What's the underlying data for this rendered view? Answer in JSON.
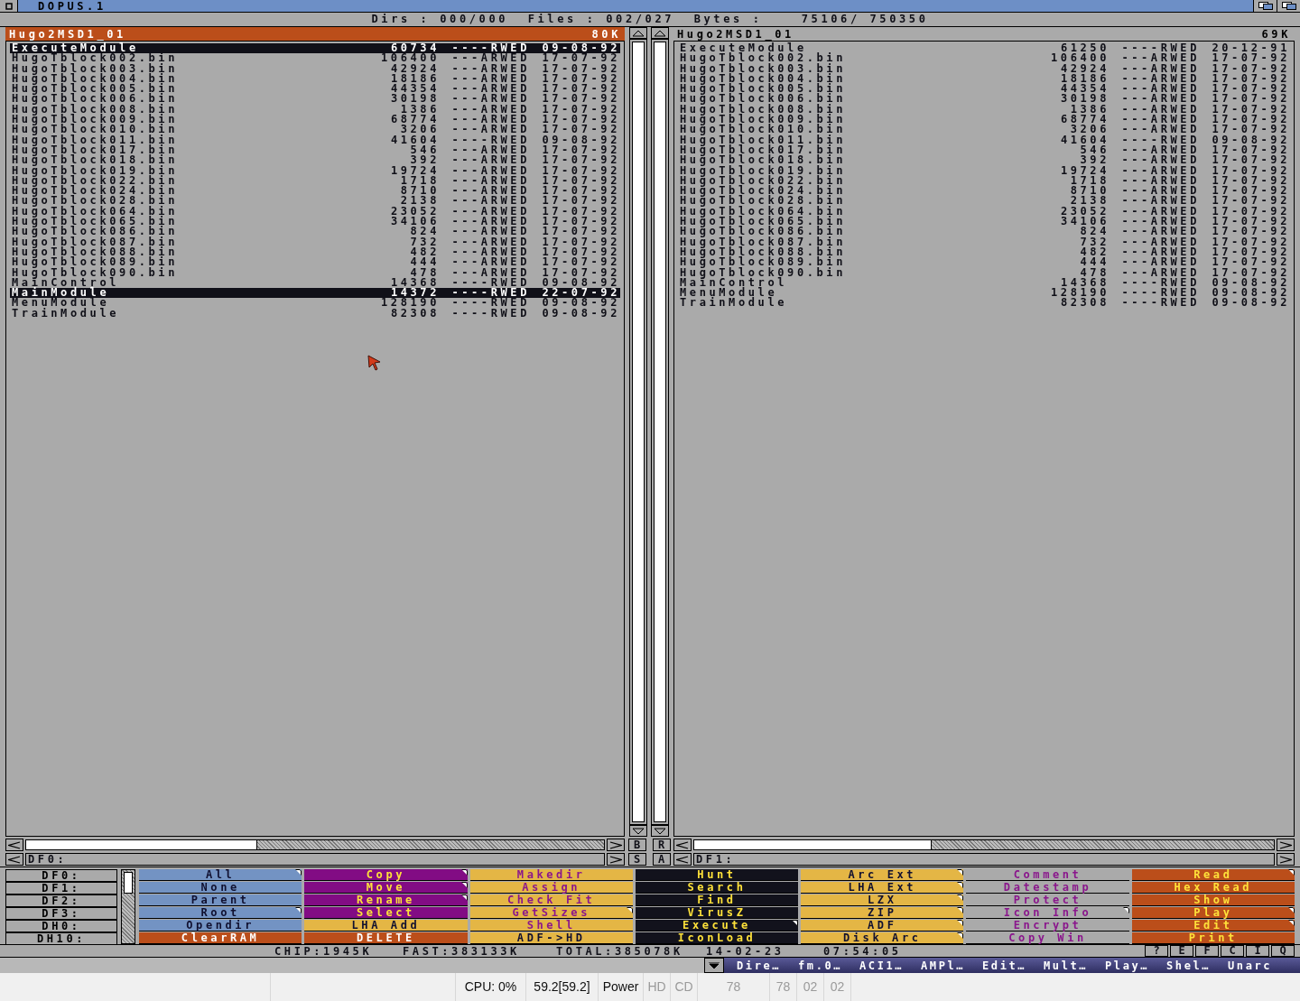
{
  "window": {
    "title": "DOPUS.1"
  },
  "info_line": "Dirs : 000/000  Files : 002/027  Bytes :    75106/ 750350",
  "panels": [
    {
      "title": "Hugo2MSD1_01",
      "free": "80K",
      "active": true,
      "path": "DF0:",
      "files": [
        {
          "name": "ExecuteModule",
          "size": "60734",
          "protection": "----RWED",
          "date": "09-08-92",
          "selected": true
        },
        {
          "name": "HugoTblock002.bin",
          "size": "106400",
          "protection": "---ARWED",
          "date": "17-07-92",
          "selected": false
        },
        {
          "name": "HugoTblock003.bin",
          "size": "42924",
          "protection": "---ARWED",
          "date": "17-07-92",
          "selected": false
        },
        {
          "name": "HugoTblock004.bin",
          "size": "18186",
          "protection": "---ARWED",
          "date": "17-07-92",
          "selected": false
        },
        {
          "name": "HugoTblock005.bin",
          "size": "44354",
          "protection": "---ARWED",
          "date": "17-07-92",
          "selected": false
        },
        {
          "name": "HugoTblock006.bin",
          "size": "30198",
          "protection": "---ARWED",
          "date": "17-07-92",
          "selected": false
        },
        {
          "name": "HugoTblock008.bin",
          "size": "1386",
          "protection": "---ARWED",
          "date": "17-07-92",
          "selected": false
        },
        {
          "name": "HugoTblock009.bin",
          "size": "68774",
          "protection": "---ARWED",
          "date": "17-07-92",
          "selected": false
        },
        {
          "name": "HugoTblock010.bin",
          "size": "3206",
          "protection": "---ARWED",
          "date": "17-07-92",
          "selected": false
        },
        {
          "name": "HugoTblock011.bin",
          "size": "41604",
          "protection": "----RWED",
          "date": "09-08-92",
          "selected": false
        },
        {
          "name": "HugoTblock017.bin",
          "size": "546",
          "protection": "---ARWED",
          "date": "17-07-92",
          "selected": false
        },
        {
          "name": "HugoTblock018.bin",
          "size": "392",
          "protection": "---ARWED",
          "date": "17-07-92",
          "selected": false
        },
        {
          "name": "HugoTblock019.bin",
          "size": "19724",
          "protection": "---ARWED",
          "date": "17-07-92",
          "selected": false
        },
        {
          "name": "HugoTblock022.bin",
          "size": "1718",
          "protection": "---ARWED",
          "date": "17-07-92",
          "selected": false
        },
        {
          "name": "HugoTblock024.bin",
          "size": "8710",
          "protection": "---ARWED",
          "date": "17-07-92",
          "selected": false
        },
        {
          "name": "HugoTblock028.bin",
          "size": "2138",
          "protection": "---ARWED",
          "date": "17-07-92",
          "selected": false
        },
        {
          "name": "HugoTblock064.bin",
          "size": "23052",
          "protection": "---ARWED",
          "date": "17-07-92",
          "selected": false
        },
        {
          "name": "HugoTblock065.bin",
          "size": "34106",
          "protection": "---ARWED",
          "date": "17-07-92",
          "selected": false
        },
        {
          "name": "HugoTblock086.bin",
          "size": "824",
          "protection": "---ARWED",
          "date": "17-07-92",
          "selected": false
        },
        {
          "name": "HugoTblock087.bin",
          "size": "732",
          "protection": "---ARWED",
          "date": "17-07-92",
          "selected": false
        },
        {
          "name": "HugoTblock088.bin",
          "size": "482",
          "protection": "---ARWED",
          "date": "17-07-92",
          "selected": false
        },
        {
          "name": "HugoTblock089.bin",
          "size": "444",
          "protection": "---ARWED",
          "date": "17-07-92",
          "selected": false
        },
        {
          "name": "HugoTblock090.bin",
          "size": "478",
          "protection": "---ARWED",
          "date": "17-07-92",
          "selected": false
        },
        {
          "name": "MainControl",
          "size": "14368",
          "protection": "----RWED",
          "date": "09-08-92",
          "selected": false
        },
        {
          "name": "MainModule",
          "size": "14372",
          "protection": "----RWED",
          "date": "22-07-92",
          "selected": true
        },
        {
          "name": "MenuModule",
          "size": "128190",
          "protection": "----RWED",
          "date": "09-08-92",
          "selected": false
        },
        {
          "name": "TrainModule",
          "size": "82308",
          "protection": "----RWED",
          "date": "09-08-92",
          "selected": false
        }
      ]
    },
    {
      "title": "Hugo2MSD1_01",
      "free": "69K",
      "active": false,
      "path": "DF1:",
      "files": [
        {
          "name": "ExecuteModule",
          "size": "61250",
          "protection": "----RWED",
          "date": "20-12-91",
          "selected": false
        },
        {
          "name": "HugoTblock002.bin",
          "size": "106400",
          "protection": "---ARWED",
          "date": "17-07-92",
          "selected": false
        },
        {
          "name": "HugoTblock003.bin",
          "size": "42924",
          "protection": "---ARWED",
          "date": "17-07-92",
          "selected": false
        },
        {
          "name": "HugoTblock004.bin",
          "size": "18186",
          "protection": "---ARWED",
          "date": "17-07-92",
          "selected": false
        },
        {
          "name": "HugoTblock005.bin",
          "size": "44354",
          "protection": "---ARWED",
          "date": "17-07-92",
          "selected": false
        },
        {
          "name": "HugoTblock006.bin",
          "size": "30198",
          "protection": "---ARWED",
          "date": "17-07-92",
          "selected": false
        },
        {
          "name": "HugoTblock008.bin",
          "size": "1386",
          "protection": "---ARWED",
          "date": "17-07-92",
          "selected": false
        },
        {
          "name": "HugoTblock009.bin",
          "size": "68774",
          "protection": "---ARWED",
          "date": "17-07-92",
          "selected": false
        },
        {
          "name": "HugoTblock010.bin",
          "size": "3206",
          "protection": "---ARWED",
          "date": "17-07-92",
          "selected": false
        },
        {
          "name": "HugoTblock011.bin",
          "size": "41604",
          "protection": "----RWED",
          "date": "09-08-92",
          "selected": false
        },
        {
          "name": "HugoTblock017.bin",
          "size": "546",
          "protection": "---ARWED",
          "date": "17-07-92",
          "selected": false
        },
        {
          "name": "HugoTblock018.bin",
          "size": "392",
          "protection": "---ARWED",
          "date": "17-07-92",
          "selected": false
        },
        {
          "name": "HugoTblock019.bin",
          "size": "19724",
          "protection": "---ARWED",
          "date": "17-07-92",
          "selected": false
        },
        {
          "name": "HugoTblock022.bin",
          "size": "1718",
          "protection": "---ARWED",
          "date": "17-07-92",
          "selected": false
        },
        {
          "name": "HugoTblock024.bin",
          "size": "8710",
          "protection": "---ARWED",
          "date": "17-07-92",
          "selected": false
        },
        {
          "name": "HugoTblock028.bin",
          "size": "2138",
          "protection": "---ARWED",
          "date": "17-07-92",
          "selected": false
        },
        {
          "name": "HugoTblock064.bin",
          "size": "23052",
          "protection": "---ARWED",
          "date": "17-07-92",
          "selected": false
        },
        {
          "name": "HugoTblock065.bin",
          "size": "34106",
          "protection": "---ARWED",
          "date": "17-07-92",
          "selected": false
        },
        {
          "name": "HugoTblock086.bin",
          "size": "824",
          "protection": "---ARWED",
          "date": "17-07-92",
          "selected": false
        },
        {
          "name": "HugoTblock087.bin",
          "size": "732",
          "protection": "---ARWED",
          "date": "17-07-92",
          "selected": false
        },
        {
          "name": "HugoTblock088.bin",
          "size": "482",
          "protection": "---ARWED",
          "date": "17-07-92",
          "selected": false
        },
        {
          "name": "HugoTblock089.bin",
          "size": "444",
          "protection": "---ARWED",
          "date": "17-07-92",
          "selected": false
        },
        {
          "name": "HugoTblock090.bin",
          "size": "478",
          "protection": "---ARWED",
          "date": "17-07-92",
          "selected": false
        },
        {
          "name": "MainControl",
          "size": "14368",
          "protection": "----RWED",
          "date": "09-08-92",
          "selected": false
        },
        {
          "name": "MenuModule",
          "size": "128190",
          "protection": "----RWED",
          "date": "09-08-92",
          "selected": false
        },
        {
          "name": "TrainModule",
          "size": "82308",
          "protection": "----RWED",
          "date": "09-08-92",
          "selected": false
        }
      ]
    }
  ],
  "middle_buttons": [
    "B",
    "R",
    "S",
    "A"
  ],
  "devices": [
    "DF0:",
    "DF1:",
    "DF2:",
    "DF3:",
    "DH0:",
    "DH10:"
  ],
  "buttons": [
    {
      "label": "All",
      "color": "#7393c3",
      "kind": "dark",
      "menu": true
    },
    {
      "label": "Copy",
      "color": "#820c84",
      "kind": "yellow",
      "menu": true
    },
    {
      "label": "Makedir",
      "color": "#e4b645",
      "kind": "purple",
      "menu": false
    },
    {
      "label": "Hunt",
      "color": "#12121c",
      "kind": "yellow",
      "menu": false
    },
    {
      "label": "Arc Ext",
      "color": "#e4b645",
      "kind": "dark",
      "menu": true
    },
    {
      "label": "Comment",
      "color": "#aaaaaa",
      "kind": "purple",
      "menu": false
    },
    {
      "label": "Read",
      "color": "#bb4e1a",
      "kind": "yellow",
      "menu": true
    },
    {
      "label": "None",
      "color": "#7393c3",
      "kind": "dark",
      "menu": false
    },
    {
      "label": "Move",
      "color": "#820c84",
      "kind": "yellow",
      "menu": true
    },
    {
      "label": "Assign",
      "color": "#e4b645",
      "kind": "purple",
      "menu": false
    },
    {
      "label": "Search",
      "color": "#12121c",
      "kind": "yellow",
      "menu": false
    },
    {
      "label": "LHA Ext",
      "color": "#e4b645",
      "kind": "dark",
      "menu": true
    },
    {
      "label": "Datestamp",
      "color": "#aaaaaa",
      "kind": "purple",
      "menu": false
    },
    {
      "label": "Hex Read",
      "color": "#bb4e1a",
      "kind": "yellow",
      "menu": false
    },
    {
      "label": "Parent",
      "color": "#7393c3",
      "kind": "dark",
      "menu": false
    },
    {
      "label": "Rename",
      "color": "#820c84",
      "kind": "yellow",
      "menu": true
    },
    {
      "label": "Check Fit",
      "color": "#e4b645",
      "kind": "purple",
      "menu": false
    },
    {
      "label": "Find",
      "color": "#12121c",
      "kind": "yellow",
      "menu": false
    },
    {
      "label": "LZX",
      "color": "#e4b645",
      "kind": "dark",
      "menu": true
    },
    {
      "label": "Protect",
      "color": "#aaaaaa",
      "kind": "purple",
      "menu": false
    },
    {
      "label": "Show",
      "color": "#bb4e1a",
      "kind": "yellow",
      "menu": false
    },
    {
      "label": "Root",
      "color": "#7393c3",
      "kind": "dark",
      "menu": true
    },
    {
      "label": "Select",
      "color": "#820c84",
      "kind": "yellow",
      "menu": false
    },
    {
      "label": "GetSizes",
      "color": "#e4b645",
      "kind": "purple",
      "menu": true
    },
    {
      "label": "VirusZ",
      "color": "#12121c",
      "kind": "yellow",
      "menu": false
    },
    {
      "label": "ZIP",
      "color": "#e4b645",
      "kind": "dark",
      "menu": true
    },
    {
      "label": "Icon Info",
      "color": "#aaaaaa",
      "kind": "purple",
      "menu": true
    },
    {
      "label": "Play",
      "color": "#bb4e1a",
      "kind": "yellow",
      "menu": true
    },
    {
      "label": "Opendir",
      "color": "#7393c3",
      "kind": "dark",
      "menu": false
    },
    {
      "label": "LHA Add",
      "color": "#e4b645",
      "kind": "dark",
      "menu": false
    },
    {
      "label": "Shell",
      "color": "#e4b645",
      "kind": "purple",
      "menu": false
    },
    {
      "label": "Execute",
      "color": "#12121c",
      "kind": "yellow",
      "menu": true
    },
    {
      "label": "ADF",
      "color": "#e4b645",
      "kind": "dark",
      "menu": true
    },
    {
      "label": "Encrypt",
      "color": "#aaaaaa",
      "kind": "purple",
      "menu": false
    },
    {
      "label": "Edit",
      "color": "#bb4e1a",
      "kind": "yellow",
      "menu": true
    },
    {
      "label": "ClearRAM",
      "color": "#bb4e1a",
      "kind": "white",
      "menu": false
    },
    {
      "label": "DELETE",
      "color": "#bb4e1a",
      "kind": "white",
      "menu": false
    },
    {
      "label": "ADF->HD",
      "color": "#e4b645",
      "kind": "dark",
      "menu": false
    },
    {
      "label": "IconLoad",
      "color": "#12121c",
      "kind": "yellow",
      "menu": false
    },
    {
      "label": "Disk Arc",
      "color": "#e4b645",
      "kind": "dark",
      "menu": true
    },
    {
      "label": "Copy Win",
      "color": "#aaaaaa",
      "kind": "purple",
      "menu": false
    },
    {
      "label": "Print",
      "color": "#bb4e1a",
      "kind": "yellow",
      "menu": false
    }
  ],
  "status": [
    "CHIP:1945K",
    "FAST:383133K",
    "TOTAL:385078K",
    "14-02-23",
    "07:54:05"
  ],
  "help_buttons": [
    "?",
    "E",
    "F",
    "C",
    "I",
    "Q"
  ],
  "taskbar": [
    "Dire…",
    "fm.0…",
    "ACI1…",
    "AMPl…",
    "Edit…",
    "Mult…",
    "Play…",
    "Shel…",
    "Unarc"
  ],
  "system_bar": [
    {
      "text": "CPU: 0%",
      "enabled": true
    },
    {
      "text": "59.2[59.2]",
      "enabled": true
    },
    {
      "text": "Power",
      "enabled": true
    },
    {
      "text": "HD",
      "enabled": false
    },
    {
      "text": "CD",
      "enabled": false
    },
    {
      "text": "78",
      "enabled": false
    },
    {
      "text": "78",
      "enabled": false
    },
    {
      "text": "02",
      "enabled": false
    },
    {
      "text": "02",
      "enabled": false
    }
  ]
}
